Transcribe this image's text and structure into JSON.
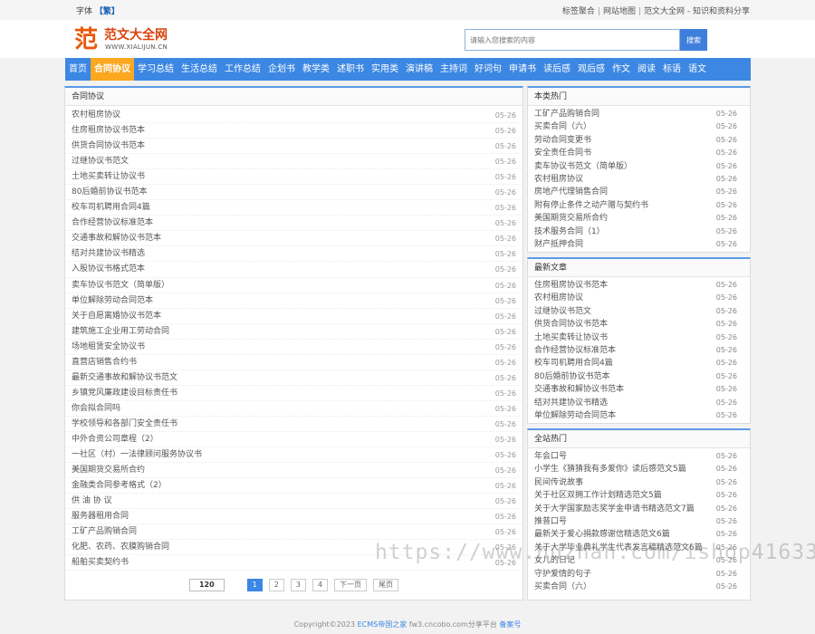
{
  "topbar": {
    "font_label": "字体",
    "font_switch": "【繁】",
    "links": [
      "标签聚合",
      "网站地图",
      "范文大全网 - 知识和资料分享"
    ]
  },
  "logo": {
    "char": "范",
    "name": "范文大全网",
    "url": "WWW.XIALIJUN.CN"
  },
  "search": {
    "placeholder": "请输入您搜索的内容",
    "button": "搜索"
  },
  "nav": {
    "items": [
      "首页",
      "合同协议",
      "学习总结",
      "生活总结",
      "工作总结",
      "企划书",
      "教学类",
      "述职书",
      "实用类",
      "演讲稿",
      "主持词",
      "好词句",
      "申请书",
      "读后感",
      "观后感",
      "作文",
      "阅读",
      "标语",
      "语文"
    ],
    "active_index": 1
  },
  "main": {
    "title": "合同协议",
    "items": [
      {
        "title": "农村租房协议",
        "date": "05-26"
      },
      {
        "title": "住房租房协议书范本",
        "date": "05-26"
      },
      {
        "title": "供货合同协议书范本",
        "date": "05-26"
      },
      {
        "title": "过继协议书范文",
        "date": "05-26"
      },
      {
        "title": "土地买卖转让协议书",
        "date": "05-26"
      },
      {
        "title": "80后婚前协议书范本",
        "date": "05-26"
      },
      {
        "title": "校车司机聘用合同4篇",
        "date": "05-26"
      },
      {
        "title": "合作经营协议标准范本",
        "date": "05-26"
      },
      {
        "title": "交通事故和解协议书范本",
        "date": "05-26"
      },
      {
        "title": "结对共建协议书精选",
        "date": "05-26"
      },
      {
        "title": "入股协议书格式范本",
        "date": "05-26"
      },
      {
        "title": "卖车协议书范文（简单版）",
        "date": "05-26"
      },
      {
        "title": "单位解除劳动合同范本",
        "date": "05-26"
      },
      {
        "title": "关于自愿离婚协议书范本",
        "date": "05-26"
      },
      {
        "title": "建筑施工企业用工劳动合同",
        "date": "05-26"
      },
      {
        "title": "场地租赁安全协议书",
        "date": "05-26"
      },
      {
        "title": "直营店销售合约书",
        "date": "05-26"
      },
      {
        "title": "最新交通事故和解协议书范文",
        "date": "05-26"
      },
      {
        "title": "乡镇党风廉政建设目标责任书",
        "date": "05-26"
      },
      {
        "title": "你会拟合同吗",
        "date": "05-26"
      },
      {
        "title": "学校领导和各部门安全责任书",
        "date": "05-26"
      },
      {
        "title": "中外合资公司章程（2）",
        "date": "05-26"
      },
      {
        "title": "一社区（村）一法律顾问服务协议书",
        "date": "05-26"
      },
      {
        "title": "美国期货交易所合约",
        "date": "05-26"
      },
      {
        "title": "金融类合同参考格式（2）",
        "date": "05-26"
      },
      {
        "title": "供 油 协 议",
        "date": "05-26"
      },
      {
        "title": "服务器租用合同",
        "date": "05-26"
      },
      {
        "title": "工矿产品购销合同",
        "date": "05-26"
      },
      {
        "title": "化肥、农药、农膜购销合同",
        "date": "05-26"
      },
      {
        "title": "船舶买卖契约书",
        "date": "05-26"
      }
    ]
  },
  "pager": {
    "total": "120",
    "pages": [
      "1",
      "2",
      "3",
      "4"
    ],
    "next": "下一页",
    "last": "尾页"
  },
  "side_hot": {
    "title": "本类热门",
    "items": [
      {
        "title": "工矿产品购销合同",
        "date": "05-26"
      },
      {
        "title": "买卖合同（六）",
        "date": "05-26"
      },
      {
        "title": "劳动合同变更书",
        "date": "05-26"
      },
      {
        "title": "安全责任合同书",
        "date": "05-26"
      },
      {
        "title": "卖车协议书范文（简单版）",
        "date": "05-26"
      },
      {
        "title": "农村租房协议",
        "date": "05-26"
      },
      {
        "title": "房地产代理销售合同",
        "date": "05-26"
      },
      {
        "title": "附有停止条件之动产赠与契约书",
        "date": "05-26"
      },
      {
        "title": "美国期货交易所合约",
        "date": "05-26"
      },
      {
        "title": "技术服务合同（1）",
        "date": "05-26"
      },
      {
        "title": "财产抵押合同",
        "date": "05-26"
      }
    ]
  },
  "side_new": {
    "title": "最新文章",
    "items": [
      {
        "title": "住房租房协议书范本",
        "date": "05-26"
      },
      {
        "title": "农村租房协议",
        "date": "05-26"
      },
      {
        "title": "过继协议书范文",
        "date": "05-26"
      },
      {
        "title": "供货合同协议书范本",
        "date": "05-26"
      },
      {
        "title": "土地买卖转让协议书",
        "date": "05-26"
      },
      {
        "title": "合作经营协议标准范本",
        "date": "05-26"
      },
      {
        "title": "校车司机聘用合同4篇",
        "date": "05-26"
      },
      {
        "title": "80后婚前协议书范本",
        "date": "05-26"
      },
      {
        "title": "交通事故和解协议书范本",
        "date": "05-26"
      },
      {
        "title": "结对共建协议书精选",
        "date": "05-26"
      },
      {
        "title": "单位解除劳动合同范本",
        "date": "05-26"
      }
    ]
  },
  "side_site": {
    "title": "全站热门",
    "items": [
      {
        "title": "年会口号",
        "date": "05-26"
      },
      {
        "title": "小学生《猜猜我有多爱你》读后感范文5篇",
        "date": "05-26"
      },
      {
        "title": "民间传说故事",
        "date": "05-26"
      },
      {
        "title": "关于社区双拥工作计划精选范文5篇",
        "date": "05-26"
      },
      {
        "title": "关于大学国家励志奖学金申请书精选范文7篇",
        "date": "05-26"
      },
      {
        "title": "推普口号",
        "date": "05-26"
      },
      {
        "title": "最新关于爱心捐款感谢信精选范文6篇",
        "date": "05-26"
      },
      {
        "title": "关于大学毕业典礼学生代表发言稿精选范文6篇",
        "date": "05-26"
      },
      {
        "title": "女儿的日记",
        "date": "05-26"
      },
      {
        "title": "守护爱情的句子",
        "date": "05-26"
      },
      {
        "title": "买卖合同（六）",
        "date": "05-26"
      }
    ]
  },
  "footer": {
    "prefix": "Copyright©2023 ",
    "cms": "ECMS帝国之家",
    "mid": " fw3.cncobo.com分享平台 ",
    "icp": "备案号"
  },
  "watermark": "https://www.huzhan.com/ishop41633"
}
